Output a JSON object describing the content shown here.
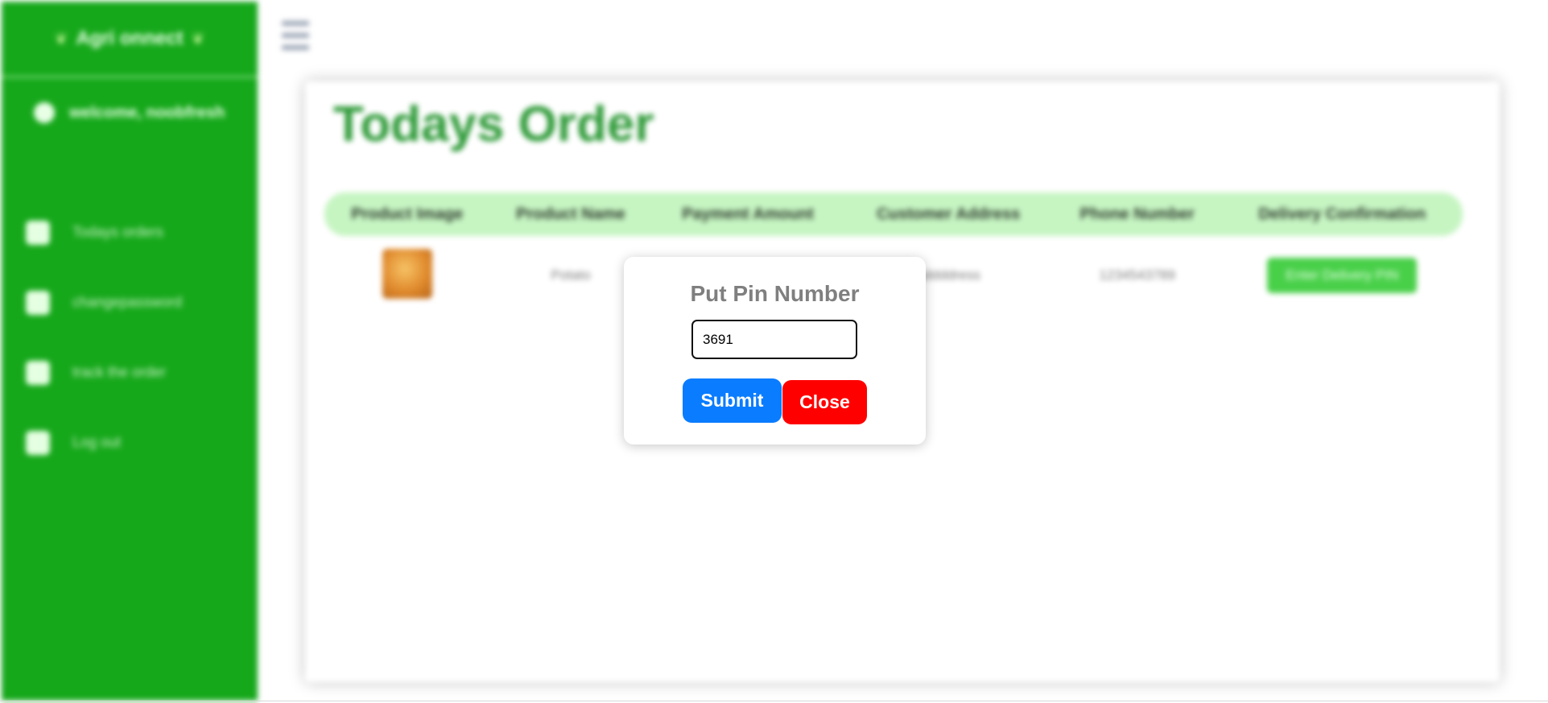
{
  "sidebar": {
    "brand": "Agri  onnect",
    "welcome": "welcome, noobfresh",
    "items": [
      {
        "label": "Todays orders",
        "icon": "home-icon"
      },
      {
        "label": "changepassword",
        "icon": "lock-icon"
      },
      {
        "label": "track the order",
        "icon": "location-pin-icon"
      },
      {
        "label": "Log out",
        "icon": "trash-icon"
      }
    ]
  },
  "main": {
    "title": "Todays Order",
    "table": {
      "headers": [
        "Product Image",
        "Product Name",
        "Payment Amount",
        "Customer Address",
        "Phone Number",
        "Delivery Confirmation"
      ],
      "rows": [
        {
          "product_name": "Potato",
          "payment_amount": "",
          "customer_address": "addddress",
          "phone_number": "1234543789",
          "action_label": "Enter Delivery PIN"
        }
      ]
    }
  },
  "modal": {
    "title": "Put Pin Number",
    "pin_value": "3691",
    "submit_label": "Submit",
    "close_label": "Close"
  },
  "colors": {
    "sidebar": "#16a81b",
    "title": "#2e9a38",
    "table_header": "#c6f5c2",
    "submit": "#0a7cff",
    "close": "#ff0000"
  }
}
